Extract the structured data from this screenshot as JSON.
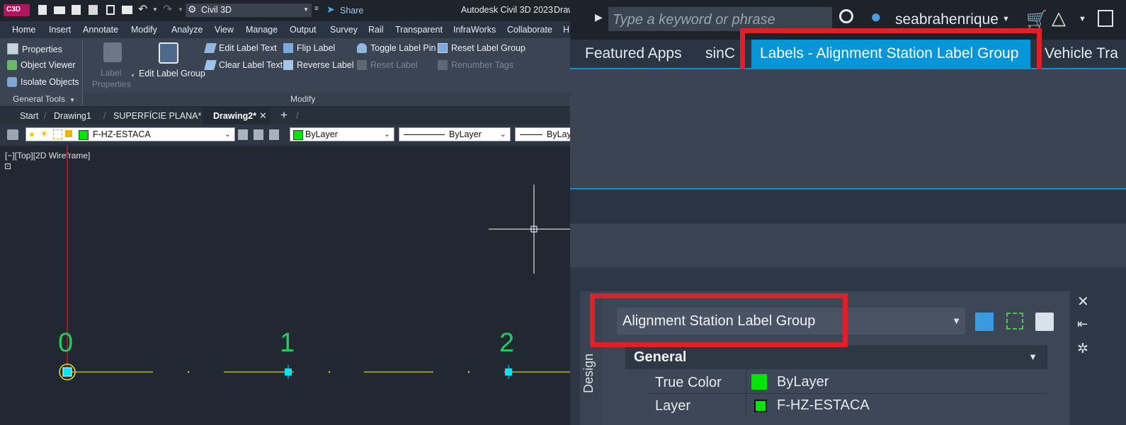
{
  "title_bar": {
    "app_badge": "C3D",
    "workspace": "Civil 3D",
    "share_label": "Share",
    "app_title": "Autodesk Civil 3D 2023",
    "title_suffix": "Draw"
  },
  "menu": [
    "Home",
    "Insert",
    "Annotate",
    "Modify",
    "Analyze",
    "View",
    "Manage",
    "Output",
    "Survey",
    "Rail",
    "Transparent",
    "InfraWorks",
    "Collaborate",
    "H"
  ],
  "ribbon": {
    "general_tools": {
      "properties": "Properties",
      "object_viewer": "Object Viewer",
      "isolate_objects": "Isolate Objects",
      "panel_label": "General Tools"
    },
    "modify": {
      "label_properties_line1": "Label",
      "label_properties_line2": "Properties",
      "edit_label_group": "Edit Label Group",
      "edit_label_text": "Edit Label Text",
      "clear_label_text": "Clear Label Text",
      "flip_label": "Flip Label",
      "reverse_label": "Reverse Label",
      "toggle_label_pin": "Toggle Label Pin",
      "reset_label": "Reset Label",
      "reset_label_group": "Reset Label Group",
      "renumber_tags": "Renumber Tags",
      "panel_label": "Modify"
    }
  },
  "file_tabs": [
    "Start",
    "Drawing1",
    "SUPERFÍCIE PLANA*",
    "Drawing2*"
  ],
  "layer_bar": {
    "layer": "F-HZ-ESTACA",
    "color": "ByLayer",
    "linetype": "ByLayer",
    "lineweight": "ByLay"
  },
  "viewport_label": "[−][Top][2D Wireframe]",
  "station_labels": [
    "0",
    "1",
    "2"
  ],
  "right": {
    "search_placeholder": "Type a keyword or phrase",
    "username": "seabrahenrique",
    "tabs": [
      "Featured Apps",
      "sinC",
      "Labels - Alignment Station Label Group",
      "Vehicle Tra"
    ],
    "palette": {
      "object_type": "Alignment Station Label Group",
      "side_label": "Design",
      "section": "General",
      "rows": [
        {
          "name": "True Color",
          "value": "ByLayer"
        },
        {
          "name": "Layer",
          "value": "F-HZ-ESTACA"
        }
      ]
    }
  },
  "colors": {
    "accent_blue": "#0696d7",
    "highlight_red": "#e01f26",
    "station_green": "#1fce62",
    "layer_green": "#00e600"
  }
}
